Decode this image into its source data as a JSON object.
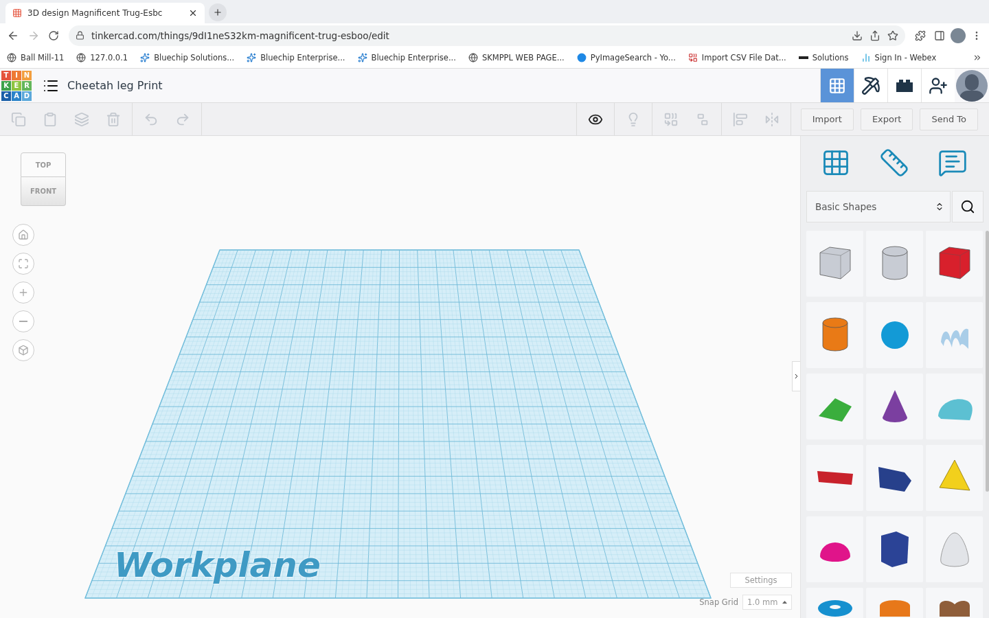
{
  "browser": {
    "tab": {
      "title": "3D design Magnificent Trug-Esbc"
    },
    "nav": [
      {
        "kind": "back",
        "disabled": false
      },
      {
        "kind": "forward",
        "disabled": true
      },
      {
        "kind": "reload",
        "disabled": false
      }
    ],
    "address": "tinkercad.com/things/9dI1neS32km-magnificent-trug-esboo/edit",
    "bookmarks": [
      {
        "kind": "globe",
        "label": "Ball Mill-11"
      },
      {
        "kind": "globe",
        "label": "127.0.0.1"
      },
      {
        "kind": "sparkle",
        "label": "Bluechip Solutions..."
      },
      {
        "kind": "sparkle",
        "label": "Bluechip Enterprise..."
      },
      {
        "kind": "sparkle",
        "label": "Bluechip Enterprise..."
      },
      {
        "kind": "globe",
        "label": "SKMPPL WEB PAGE..."
      },
      {
        "kind": "disc",
        "label": "PyImageSearch - Yo..."
      },
      {
        "kind": "cw",
        "label": "Import CSV File Dat..."
      },
      {
        "kind": "dash",
        "label": "Solutions"
      },
      {
        "kind": "bars",
        "label": "Sign In - Webex"
      }
    ]
  },
  "app": {
    "logo_letters": [
      {
        "letter": "T",
        "color": "#e5533d"
      },
      {
        "letter": "I",
        "color": "#ee7a35"
      },
      {
        "letter": "N",
        "color": "#f29e3d"
      },
      {
        "letter": "K",
        "color": "#3ea24a"
      },
      {
        "letter": "E",
        "color": "#8fc440"
      },
      {
        "letter": "R",
        "color": "#63b65a"
      },
      {
        "letter": "C",
        "color": "#1b5fa8"
      },
      {
        "letter": "A",
        "color": "#2a83c9"
      },
      {
        "letter": "D",
        "color": "#5ba8da"
      }
    ],
    "title": "Cheetah leg Print",
    "header_buttons": [
      {
        "kind": "grid",
        "selected": true
      },
      {
        "kind": "pickaxe",
        "selected": false
      },
      {
        "kind": "bricks",
        "selected": false
      },
      {
        "kind": "add-user",
        "selected": false
      }
    ]
  },
  "toolbar": {
    "tools": [
      {
        "kind": "copy",
        "disabled": true
      },
      {
        "kind": "paste",
        "disabled": true
      },
      {
        "kind": "duplicate",
        "disabled": true
      },
      {
        "kind": "delete",
        "disabled": true
      },
      {
        "kind": "undo",
        "disabled": true
      },
      {
        "kind": "redo",
        "disabled": true
      },
      {
        "kind": "notes",
        "disabled": false
      },
      {
        "kind": "light",
        "disabled": true
      },
      {
        "kind": "group",
        "disabled": true
      },
      {
        "kind": "ungroup",
        "disabled": true
      },
      {
        "kind": "align",
        "disabled": true
      },
      {
        "kind": "mirror",
        "disabled": true
      }
    ],
    "buttons": [
      "Import",
      "Export",
      "Send To"
    ]
  },
  "view_cube": {
    "top": "TOP",
    "front": "FRONT"
  },
  "nav_controls": [
    {
      "kind": "home"
    },
    {
      "kind": "fit"
    },
    {
      "kind": "zoom-in"
    },
    {
      "kind": "zoom-out"
    },
    {
      "kind": "perspective"
    }
  ],
  "workplane": {
    "label": "Workplane"
  },
  "settings": {
    "button": "Settings",
    "snap_label": "Snap Grid",
    "snap_value": "1.0 mm"
  },
  "panel": {
    "tools": [
      {
        "kind": "workplane"
      },
      {
        "kind": "ruler"
      },
      {
        "kind": "notes"
      }
    ],
    "category": "Basic Shapes",
    "shapes": [
      {
        "kind": "box",
        "color": "#c8ccd4"
      },
      {
        "kind": "cylinder",
        "color": "#c8ccd4"
      },
      {
        "kind": "box",
        "color": "#d8202c"
      },
      {
        "kind": "cylinder",
        "color": "#e97a16"
      },
      {
        "kind": "sphere",
        "color": "#139ad6"
      },
      {
        "kind": "scribble",
        "color": "#a9cde8"
      },
      {
        "kind": "roof",
        "color": "#3aae3d"
      },
      {
        "kind": "cone",
        "color": "#7b3fa0"
      },
      {
        "kind": "round-roof",
        "color": "#5cc0d2"
      },
      {
        "kind": "text",
        "color": "#c8222c"
      },
      {
        "kind": "prism",
        "color": "#27408b"
      },
      {
        "kind": "pyramid",
        "color": "#f2d01c"
      },
      {
        "kind": "half-sphere",
        "color": "#e0148a"
      },
      {
        "kind": "polygon",
        "color": "#2b4396"
      },
      {
        "kind": "paraboloid",
        "color": "#e2e4e8"
      },
      {
        "kind": "torus",
        "color": "#1690cf"
      },
      {
        "kind": "tube",
        "color": "#e7781a"
      },
      {
        "kind": "heart",
        "color": "#8f5e3a"
      }
    ]
  }
}
